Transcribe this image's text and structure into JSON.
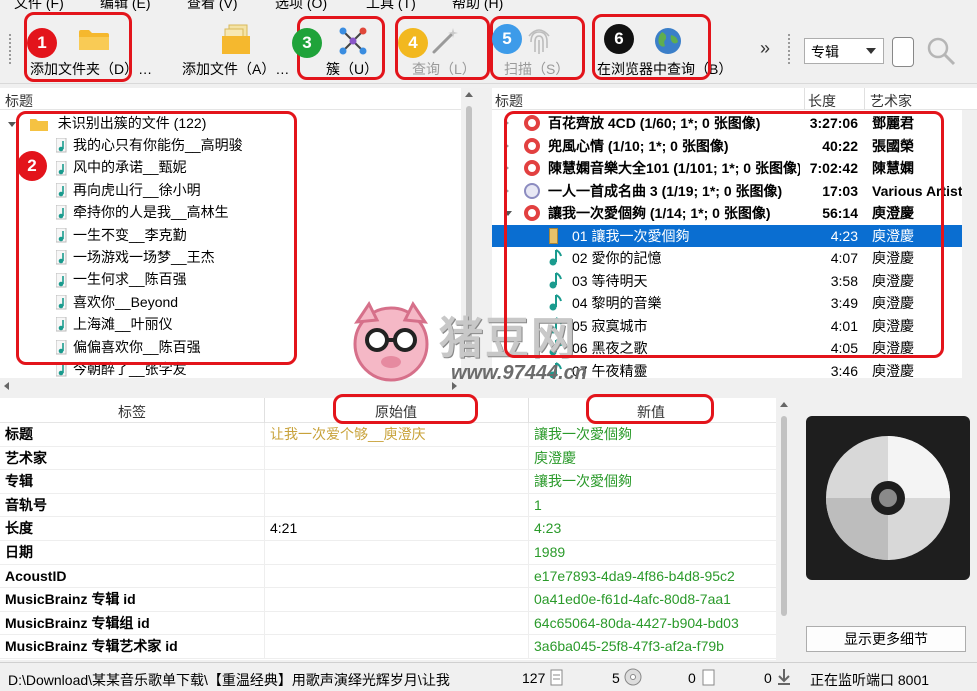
{
  "menu": [
    "文件 (F)",
    "编辑 (E)",
    "查看 (V)",
    "选项 (O)",
    "工具 (T)",
    "帮助 (H)"
  ],
  "toolbar": {
    "add_folder": "添加文件夹（D）…",
    "add_files": "添加文件（A）…",
    "cluster": "簇（U）",
    "lookup": "查询（L）",
    "scan": "扫描（S）",
    "browser_lookup": "在浏览器中查询（B）",
    "more": "»",
    "search_type": "专辑",
    "badges": [
      "1",
      "3",
      "4",
      "5",
      "6"
    ],
    "colors": {
      "red": "#e3141b",
      "green": "#1fa33a",
      "yellow": "#f2b81f",
      "blue": "#3d9be9",
      "black": "#111111"
    }
  },
  "left_panel": {
    "header": "标题",
    "root": "未识别出簇的文件 (122)",
    "badge": "2",
    "files": [
      "我的心只有你能伤__高明骏",
      "风中的承诺__甄妮",
      "再向虎山行__徐小明",
      "牵持你的人是我__高林生",
      "一生不变__李克勤",
      "一场游戏一场梦__王杰",
      "一生何求__陈百强",
      "喜欢你__Beyond",
      "上海滩__叶丽仪",
      "偏偏喜欢你__陈百强",
      "今朝醉了__张学友"
    ]
  },
  "right_panel": {
    "headers": [
      "标题",
      "长度",
      "艺术家"
    ],
    "albums": [
      {
        "title": "百花齊放 4CD (1/60; 1*; 0 张图像)",
        "length": "3:27:06",
        "artist": "鄧麗君",
        "icon": "red"
      },
      {
        "title": "兜風心情 (1/10; 1*; 0 张图像)",
        "length": "40:22",
        "artist": "張國榮",
        "icon": "red"
      },
      {
        "title": "陳慧嫻音樂大全101 (1/101; 1*; 0 张图像)",
        "length": "7:02:42",
        "artist": "陳慧嫻",
        "icon": "red"
      },
      {
        "title": "一人一首成名曲 3 (1/19; 1*; 0 张图像)",
        "length": "17:03",
        "artist": "Various Artists",
        "icon": "grey"
      },
      {
        "title": "讓我一次愛個夠 (1/14; 1*; 0 张图像)",
        "length": "56:14",
        "artist": "庾澄慶",
        "icon": "red"
      }
    ],
    "tracks": [
      {
        "title": "01  讓我一次愛個夠",
        "length": "4:23",
        "artist": "庾澄慶",
        "selected": true
      },
      {
        "title": "02  愛你的記憶",
        "length": "4:07",
        "artist": "庾澄慶"
      },
      {
        "title": "03  等待明天",
        "length": "3:58",
        "artist": "庾澄慶"
      },
      {
        "title": "04  黎明的音樂",
        "length": "3:49",
        "artist": "庾澄慶"
      },
      {
        "title": "05  寂寞城市",
        "length": "4:01",
        "artist": "庾澄慶"
      },
      {
        "title": "06  黑夜之歌",
        "length": "4:05",
        "artist": "庾澄慶"
      },
      {
        "title": "07  午夜精靈",
        "length": "3:46",
        "artist": "庾澄慶"
      }
    ]
  },
  "tag_table": {
    "headers": [
      "标签",
      "原始值",
      "新值"
    ],
    "rows": [
      {
        "tag": "标题",
        "orig": "让我一次爱个够__庾澄庆",
        "new": "讓我一次愛個夠"
      },
      {
        "tag": "艺术家",
        "orig": "",
        "new": "庾澄慶"
      },
      {
        "tag": "专辑",
        "orig": "",
        "new": "讓我一次愛個夠"
      },
      {
        "tag": "音轨号",
        "orig": "",
        "new": "1"
      },
      {
        "tag": "长度",
        "orig": "4:21",
        "new": "4:23"
      },
      {
        "tag": "日期",
        "orig": "",
        "new": "1989"
      },
      {
        "tag": "AcoustID",
        "orig": "",
        "new": "e17e7893-4da9-4f86-b4d8-95c2"
      },
      {
        "tag": "MusicBrainz 专辑 id",
        "orig": "",
        "new": "0a41ed0e-f61d-4afc-80d8-7aa1"
      },
      {
        "tag": "MusicBrainz 专辑组 id",
        "orig": "",
        "new": "64c65064-80da-4427-b904-bd03"
      },
      {
        "tag": "MusicBrainz 专辑艺术家 id",
        "orig": "",
        "new": "3a6ba045-25f8-47f3-af2a-f79b"
      }
    ]
  },
  "cover": {
    "more_details": "显示更多细节"
  },
  "watermark": {
    "brand": "猪豆网",
    "url": "www.97444.cn"
  },
  "status": {
    "path": "D:\\Download\\某某音乐歌单下载\\【重温经典】用歌声演绎光辉岁月\\让我",
    "files": "127",
    "albums": "5",
    "pending": "0",
    "requests": "0",
    "port": "正在监听端口  8001"
  }
}
